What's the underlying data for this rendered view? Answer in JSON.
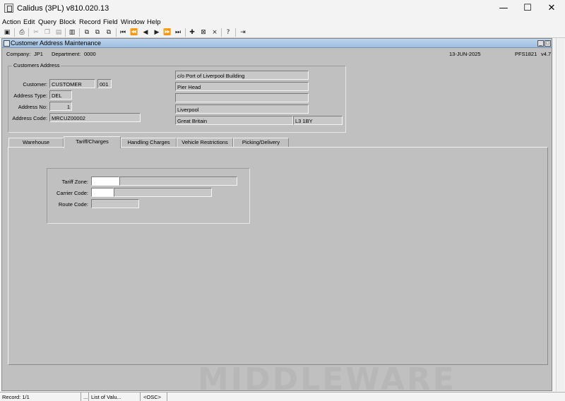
{
  "window": {
    "title": "Calidus (3PL) v810.020.13",
    "minimize": "—",
    "maximize": "☐",
    "close": "✕"
  },
  "menu": {
    "items": [
      {
        "label": "Action"
      },
      {
        "label": "Edit"
      },
      {
        "label": "Query"
      },
      {
        "label": "Block"
      },
      {
        "label": "Record"
      },
      {
        "label": "Field"
      },
      {
        "label": "Window"
      },
      {
        "label": "Help"
      }
    ]
  },
  "toolbar": {
    "icons": [
      "save-icon",
      "print-icon",
      "cut-icon",
      "copy-icon",
      "paste-icon",
      "clear-block-icon",
      "duplicate-record-icon",
      "copy-record-icon",
      "paste-record-icon",
      "first-record-icon",
      "previous-set-icon",
      "previous-record-icon",
      "next-record-icon",
      "next-set-icon",
      "last-record-icon",
      "insert-record-icon",
      "delete-record-icon",
      "clear-field-icon",
      "help-icon",
      "exit-icon"
    ]
  },
  "form": {
    "title": "Customer Address Maintenance",
    "company_label": "Company:",
    "company_value": "JP1",
    "department_label": "Department:",
    "department_value": "0000",
    "date": "13-JUN-2025",
    "screen_code": "PFS1821",
    "version": "v4.7"
  },
  "customers_address": {
    "group_title": "Customers Address",
    "customer_label": "Customer:",
    "customer_value": "CUSTOMER",
    "customer_seq": "001",
    "address_type_label": "Address Type:",
    "address_type_value": "DEL",
    "address_no_label": "Address No:",
    "address_no_value": "1",
    "address_code_label": "Address Code:",
    "address_code_value": "MRCUZ00002",
    "address_line1": "c/o Port of Liverpool Building",
    "address_line2": "Pier Head",
    "address_line3": "",
    "address_line4": "Liverpool",
    "country": "Great Britain",
    "postcode": "L3 1BY"
  },
  "tabs": [
    {
      "label": "Warehouse",
      "active": false
    },
    {
      "label": "Tariff/Charges",
      "active": true
    },
    {
      "label": "Handling Charges",
      "active": false
    },
    {
      "label": "Vehicle  Restrictions",
      "active": false
    },
    {
      "label": "Picking/Delivery",
      "active": false
    }
  ],
  "tariff": {
    "tariff_zone_label": "Tariff Zone:",
    "tariff_zone_value": "",
    "tariff_zone_desc": "",
    "carrier_code_label": "Carrier Code:",
    "carrier_code_value": "",
    "carrier_code_desc": "",
    "route_code_label": "Route Code:",
    "route_code_value": ""
  },
  "watermark": "MIDDLEWARE",
  "status": {
    "record": "Record: 1/1",
    "dots": "...",
    "list": "List of Valu...",
    "mode": "<OSC>"
  },
  "colors": {
    "form_background": "#c0c0c0",
    "form_title_bar": "#a9c6e6",
    "chrome": "#f3f3f3"
  }
}
